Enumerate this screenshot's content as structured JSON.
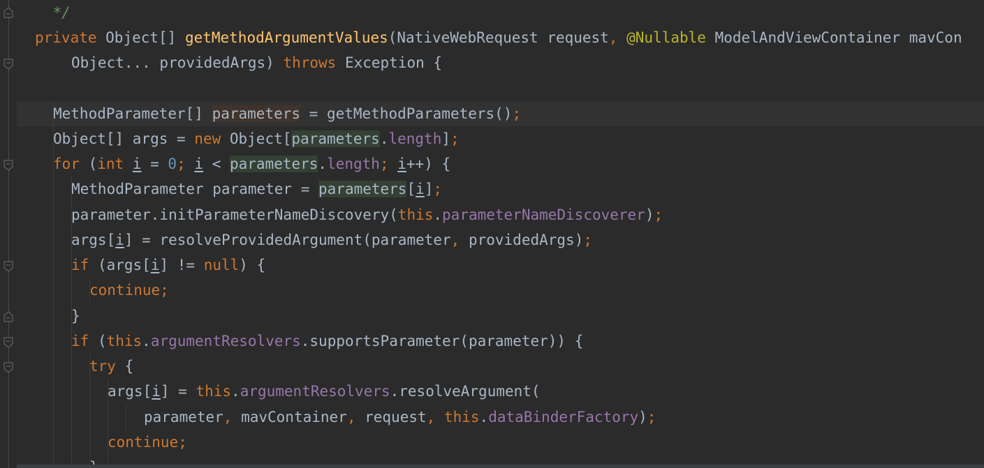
{
  "editor": {
    "lines": [
      {
        "id": "l0",
        "tokens": [
          {
            "t": " */",
            "c": "cmt"
          }
        ]
      },
      {
        "id": "l1",
        "tokens": [
          {
            "t": "private",
            "c": "kw"
          },
          {
            "t": " Object[] "
          },
          {
            "t": "getMethodArgumentValues",
            "c": "fn"
          },
          {
            "t": "(NativeWebRequest request"
          },
          {
            "t": ",",
            "c": "kw"
          },
          {
            "t": " "
          },
          {
            "t": "@Nullable",
            "c": "ann"
          },
          {
            "t": " ModelAndViewContainer mavCon"
          }
        ]
      },
      {
        "id": "l2",
        "tokens": [
          {
            "t": "Object... providedArgs) "
          },
          {
            "t": "throws",
            "c": "kw"
          },
          {
            "t": " Exception {"
          }
        ]
      },
      {
        "id": "l3",
        "tokens": []
      },
      {
        "id": "l4",
        "tokens": [
          {
            "t": "MethodParameter[] "
          },
          {
            "t": "parameters",
            "c": "hl-write"
          },
          {
            "t": " = getMethodParameters()"
          },
          {
            "t": ";",
            "c": "kw"
          }
        ]
      },
      {
        "id": "l5",
        "tokens": [
          {
            "t": "Object[] args = "
          },
          {
            "t": "new",
            "c": "kw"
          },
          {
            "t": " Object["
          },
          {
            "t": "parameters",
            "c": "hl-read"
          },
          {
            "t": ".",
            "c": ""
          },
          {
            "t": "length",
            "c": "field"
          },
          {
            "t": "]"
          },
          {
            "t": ";",
            "c": "kw"
          }
        ]
      },
      {
        "id": "l6",
        "tokens": [
          {
            "t": "for",
            "c": "kw"
          },
          {
            "t": " ("
          },
          {
            "t": "int",
            "c": "kw"
          },
          {
            "t": " "
          },
          {
            "t": "i",
            "c": "ul"
          },
          {
            "t": " = "
          },
          {
            "t": "0",
            "c": "num"
          },
          {
            "t": ";",
            "c": "kw"
          },
          {
            "t": " "
          },
          {
            "t": "i",
            "c": "ul"
          },
          {
            "t": " < "
          },
          {
            "t": "parameters",
            "c": "hl-read"
          },
          {
            "t": "."
          },
          {
            "t": "length",
            "c": "field"
          },
          {
            "t": ";",
            "c": "kw"
          },
          {
            "t": " "
          },
          {
            "t": "i",
            "c": "ul"
          },
          {
            "t": "++) {"
          }
        ]
      },
      {
        "id": "l7",
        "tokens": [
          {
            "t": "MethodParameter parameter = "
          },
          {
            "t": "parameters",
            "c": "hl-read"
          },
          {
            "t": "["
          },
          {
            "t": "i",
            "c": "ul"
          },
          {
            "t": "]"
          },
          {
            "t": ";",
            "c": "kw"
          }
        ]
      },
      {
        "id": "l8",
        "tokens": [
          {
            "t": "parameter.initParameterNameDiscovery("
          },
          {
            "t": "this",
            "c": "kw"
          },
          {
            "t": "."
          },
          {
            "t": "parameterNameDiscoverer",
            "c": "field"
          },
          {
            "t": ")"
          },
          {
            "t": ";",
            "c": "kw"
          }
        ]
      },
      {
        "id": "l9",
        "tokens": [
          {
            "t": "args["
          },
          {
            "t": "i",
            "c": "ul"
          },
          {
            "t": "] = resolveProvidedArgument(parameter"
          },
          {
            "t": ",",
            "c": "kw"
          },
          {
            "t": " providedArgs)"
          },
          {
            "t": ";",
            "c": "kw"
          }
        ]
      },
      {
        "id": "l10",
        "tokens": [
          {
            "t": "if",
            "c": "kw"
          },
          {
            "t": " (args["
          },
          {
            "t": "i",
            "c": "ul"
          },
          {
            "t": "] != "
          },
          {
            "t": "null",
            "c": "kw"
          },
          {
            "t": ") {"
          }
        ]
      },
      {
        "id": "l11",
        "tokens": [
          {
            "t": "continue",
            "c": "kw"
          },
          {
            "t": ";",
            "c": "kw"
          }
        ]
      },
      {
        "id": "l12",
        "tokens": [
          {
            "t": "}"
          }
        ]
      },
      {
        "id": "l13",
        "tokens": [
          {
            "t": "if",
            "c": "kw"
          },
          {
            "t": " ("
          },
          {
            "t": "this",
            "c": "kw"
          },
          {
            "t": "."
          },
          {
            "t": "argumentResolvers",
            "c": "field"
          },
          {
            "t": ".supportsParameter(parameter)) {"
          }
        ]
      },
      {
        "id": "l14",
        "tokens": [
          {
            "t": "try",
            "c": "kw"
          },
          {
            "t": " {"
          }
        ]
      },
      {
        "id": "l15",
        "tokens": [
          {
            "t": "args["
          },
          {
            "t": "i",
            "c": "ul"
          },
          {
            "t": "] = "
          },
          {
            "t": "this",
            "c": "kw"
          },
          {
            "t": "."
          },
          {
            "t": "argumentResolvers",
            "c": "field"
          },
          {
            "t": ".resolveArgument("
          }
        ]
      },
      {
        "id": "l16",
        "tokens": [
          {
            "t": "parameter"
          },
          {
            "t": ",",
            "c": "kw"
          },
          {
            "t": " mavContainer"
          },
          {
            "t": ",",
            "c": "kw"
          },
          {
            "t": " request"
          },
          {
            "t": ",",
            "c": "kw"
          },
          {
            "t": " "
          },
          {
            "t": "this",
            "c": "kw"
          },
          {
            "t": "."
          },
          {
            "t": "dataBinderFactory",
            "c": "field"
          },
          {
            "t": ")"
          },
          {
            "t": ";",
            "c": "kw"
          }
        ]
      },
      {
        "id": "l17",
        "tokens": [
          {
            "t": "continue",
            "c": "kw"
          },
          {
            "t": ";",
            "c": "kw"
          }
        ]
      },
      {
        "id": "l18",
        "tokens": [
          {
            "t": "}"
          }
        ]
      }
    ],
    "current_line": "l4",
    "colors": {
      "background": "#2b2b2b",
      "text": "#a9b7c6",
      "keyword": "#cc7832",
      "function": "#ffc66d",
      "annotation": "#bbb529",
      "field": "#9876aa",
      "number": "#6897bb",
      "comment": "#629755"
    }
  }
}
